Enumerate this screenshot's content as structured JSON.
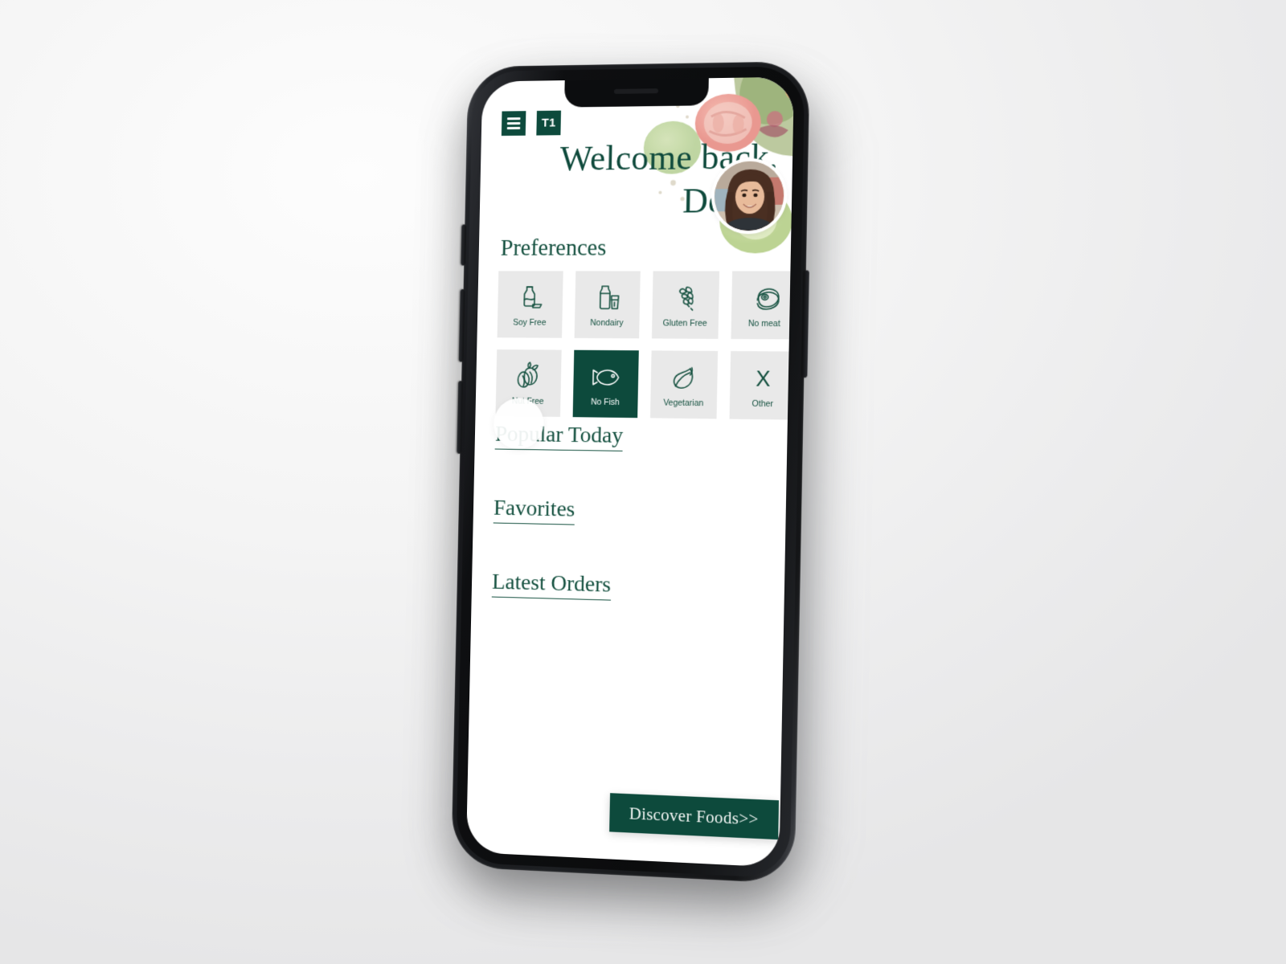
{
  "device": {
    "kind": "smartphone-mockup"
  },
  "topbar": {
    "menu_icon": "hamburger-menu-icon",
    "badge_label": "T1"
  },
  "header": {
    "greeting_line1": "Welcome back,",
    "greeting_line2": "Deniz.",
    "avatar_alt": "user-avatar-photo"
  },
  "preferences": {
    "title": "Preferences",
    "tiles": [
      {
        "label": "Soy Free",
        "icon": "soy-sauce-bottle-icon",
        "selected": false
      },
      {
        "label": "Nondairy",
        "icon": "milk-bottle-glass-icon",
        "selected": false
      },
      {
        "label": "Gluten Free",
        "icon": "wheat-stalk-icon",
        "selected": false
      },
      {
        "label": "No meat",
        "icon": "steak-icon",
        "selected": false
      },
      {
        "label": "Nut Free",
        "icon": "almonds-icon",
        "selected": false
      },
      {
        "label": "No Fish",
        "icon": "fish-icon",
        "selected": true
      },
      {
        "label": "Vegetarian",
        "icon": "leaf-icon",
        "selected": false
      },
      {
        "label": "Other",
        "icon": "x-mark-icon",
        "selected": false
      }
    ]
  },
  "sections": [
    {
      "label": "Popular Today"
    },
    {
      "label": "Favorites"
    },
    {
      "label": "Latest Orders"
    }
  ],
  "cta": {
    "label": "Discover Foods>>"
  },
  "colors": {
    "brand_green": "#0d4a3c",
    "text_green": "#14503f",
    "tile_bg": "#e9e9e9",
    "screen_bg": "#ffffff",
    "page_bg": "#efefef"
  }
}
